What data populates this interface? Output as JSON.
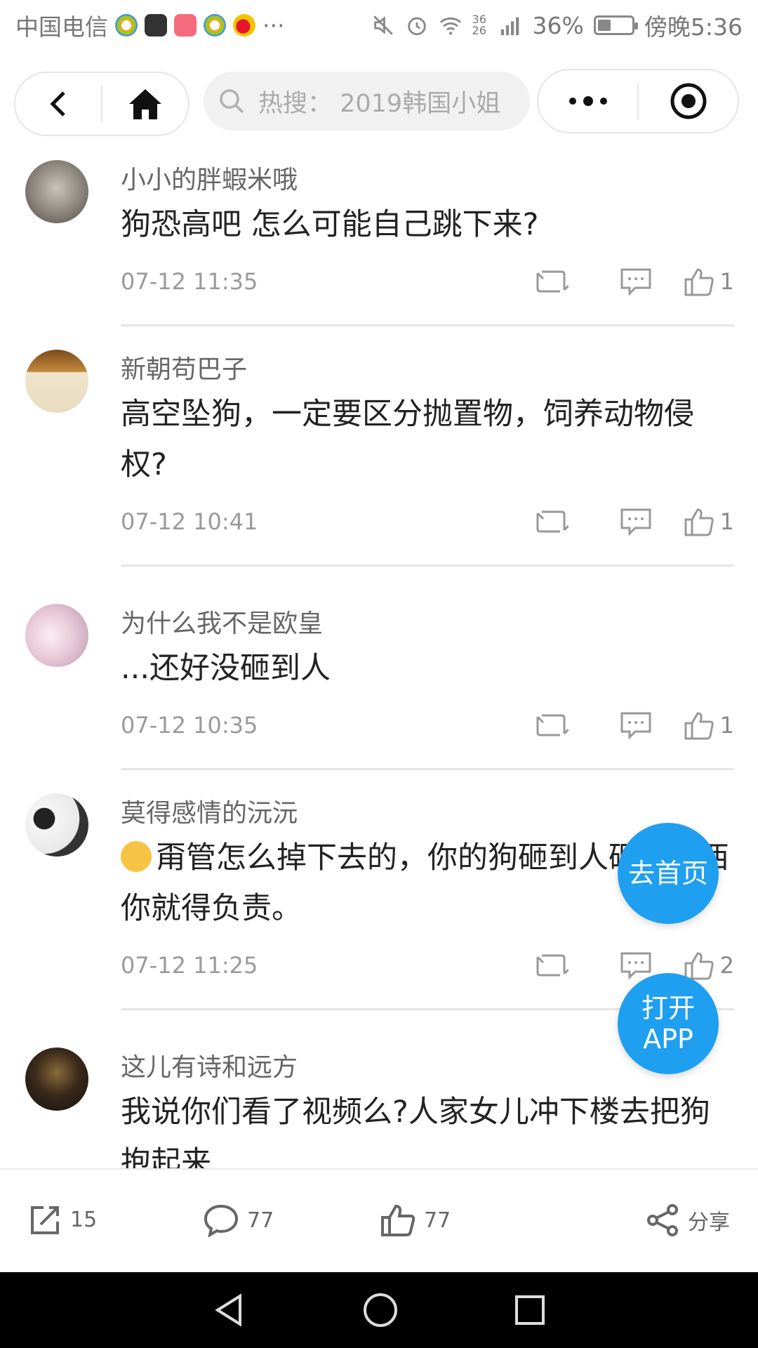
{
  "status_bar": {
    "carrier": "中国电信",
    "more": "···",
    "network": "36 26",
    "battery_percent": "36%",
    "time": "傍晚5:36"
  },
  "nav": {
    "search_placeholder": "热搜： 2019韩国小姐"
  },
  "comments": [
    {
      "user": "小小的胖蝦米哦",
      "text": "狗恐高吧 怎么可能自己跳下来?",
      "time": "07-12 11:35",
      "likes": "1"
    },
    {
      "user": "新朝苟巴子",
      "text": "高空坠狗，一定要区分抛置物，饲养动物侵权?",
      "time": "07-12 10:41",
      "likes": "1"
    },
    {
      "user": "为什么我不是欧皇",
      "text": "...还好没砸到人",
      "time": "07-12 10:35",
      "likes": "1"
    },
    {
      "user": "莫得感情的沅沅",
      "text": "甭管怎么掉下去的，你的狗砸到人砸到东西你就得负责。",
      "time": "07-12 11:25",
      "likes": "2"
    },
    {
      "user": "这儿有诗和远方",
      "text": "我说你们看了视频么?人家女儿冲下楼去把狗抱起来",
      "time": "",
      "likes": ""
    }
  ],
  "fabs": {
    "home": "去首页",
    "open_app": "打开APP"
  },
  "bottom_bar": {
    "repost_count": "15",
    "comment_count": "77",
    "like_count": "77",
    "share_label": "分享"
  },
  "colors": {
    "accent": "#1f9ff0",
    "divider": "#e6e6e6"
  }
}
